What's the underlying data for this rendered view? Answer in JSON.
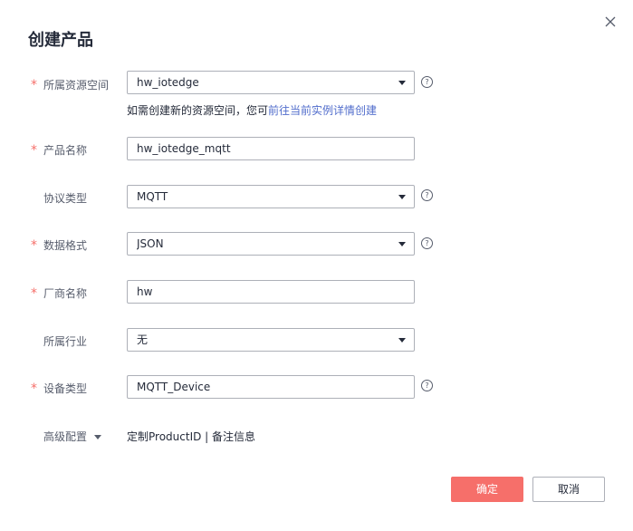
{
  "dialog": {
    "title": "创建产品",
    "close_icon": "close-icon"
  },
  "form": {
    "resource_space": {
      "label": "所属资源空间",
      "required": true,
      "value": "hw_iotedge",
      "help": "?"
    },
    "hint": {
      "text": "如需创建新的资源空间，您可",
      "link": "前往当前实例详情创建"
    },
    "product_name": {
      "label": "产品名称",
      "required": true,
      "value": "hw_iotedge_mqtt"
    },
    "protocol": {
      "label": "协议类型",
      "required": false,
      "value": "MQTT",
      "help": "?"
    },
    "data_format": {
      "label": "数据格式",
      "required": true,
      "value": "JSON",
      "help": "?"
    },
    "manufacturer": {
      "label": "厂商名称",
      "required": true,
      "value": "hw"
    },
    "industry": {
      "label": "所属行业",
      "required": false,
      "value": "无"
    },
    "device_type": {
      "label": "设备类型",
      "required": true,
      "value": "MQTT_Device",
      "help": "?"
    },
    "required_mark": "*"
  },
  "advanced": {
    "label": "高级配置",
    "link1": "定制ProductID",
    "separator": "|",
    "link2": "备注信息"
  },
  "footer": {
    "ok_label": "确定",
    "cancel_label": "取消"
  },
  "colors": {
    "primary_button": "#f66f6a",
    "link": "#526ecc",
    "required": "#f66f6a",
    "border": "#adb0b8"
  }
}
